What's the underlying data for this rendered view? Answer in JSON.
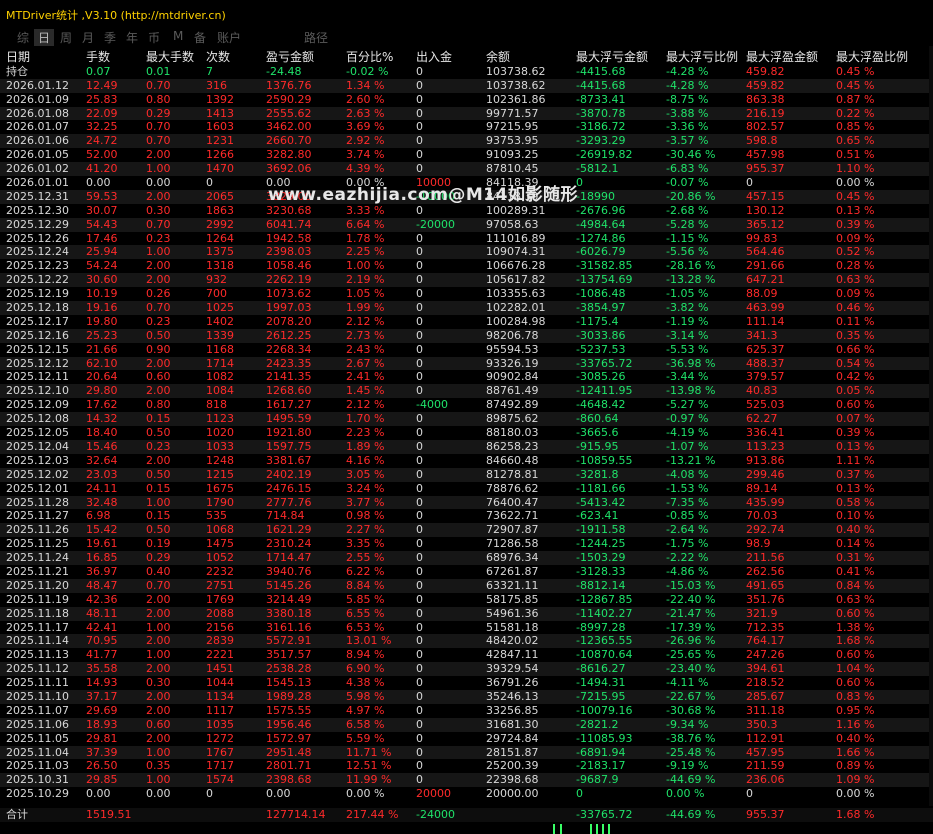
{
  "window": {
    "title": "MTDriver统计 ,V3.10 (http://mtdriver.cn)"
  },
  "tabs": [
    "综",
    "日",
    "周",
    "月",
    "季",
    "年",
    "币",
    "M",
    "备",
    "账户",
    "路径"
  ],
  "active_tab": 1,
  "watermark": "www.eazhijia.com@M14如影随形",
  "colors": {
    "green": "#1fe36a",
    "red": "#ff2a2a",
    "white": "#d8d8d8",
    "title": "#ffd200"
  },
  "table": {
    "headers": [
      "日期",
      "手数",
      "最大手数",
      "次数",
      "盈亏金额",
      "百分比%",
      "出入金",
      "余额",
      "最大浮亏金额",
      "最大浮亏比例",
      "最大浮盈金额",
      "最大浮盈比例"
    ],
    "rows": [
      [
        "持仓",
        "0.07",
        "0.01",
        "7",
        "-24.48",
        "-0.02 %",
        "0",
        "103738.62",
        "-4415.68",
        "-4.28 %",
        "459.82",
        "0.45 %"
      ],
      [
        "2026.01.12",
        "12.49",
        "0.70",
        "316",
        "1376.76",
        "1.34 %",
        "0",
        "103738.62",
        "-4415.68",
        "-4.28 %",
        "459.82",
        "0.45 %"
      ],
      [
        "2026.01.09",
        "25.83",
        "0.80",
        "1392",
        "2590.29",
        "2.60 %",
        "0",
        "102361.86",
        "-8733.41",
        "-8.75 %",
        "863.38",
        "0.87 %"
      ],
      [
        "2026.01.08",
        "22.09",
        "0.29",
        "1413",
        "2555.62",
        "2.63 %",
        "0",
        "99771.57",
        "-3870.78",
        "-3.88 %",
        "216.19",
        "0.22 %"
      ],
      [
        "2026.01.07",
        "32.25",
        "0.70",
        "1603",
        "3462.00",
        "3.69 %",
        "0",
        "97215.95",
        "-3186.72",
        "-3.36 %",
        "802.57",
        "0.85 %"
      ],
      [
        "2026.01.06",
        "24.72",
        "0.70",
        "1231",
        "2660.70",
        "2.92 %",
        "0",
        "93753.95",
        "-3293.29",
        "-3.57 %",
        "598.8",
        "0.65 %"
      ],
      [
        "2026.01.05",
        "52.00",
        "2.00",
        "1266",
        "3282.80",
        "3.74 %",
        "0",
        "91093.25",
        "-26919.82",
        "-30.46 %",
        "457.98",
        "0.51 %"
      ],
      [
        "2026.01.02",
        "41.20",
        "1.00",
        "1470",
        "3692.06",
        "4.39 %",
        "0",
        "87810.45",
        "-5812.1",
        "-6.83 %",
        "955.37",
        "1.10 %"
      ],
      [
        "2026.01.01",
        "0.00",
        "0.00",
        "0",
        "0.00",
        "0.00 %",
        "10000",
        "84118.39",
        "0",
        "-0.07 %",
        "0",
        "0.00 %"
      ],
      [
        "2025.12.31",
        "59.53",
        "2.00",
        "2065",
        "3829.00",
        "",
        "-10000",
        "84118.39",
        "-18990",
        "-20.86 %",
        "457.15",
        "0.45 %"
      ],
      [
        "2025.12.30",
        "30.07",
        "0.30",
        "1863",
        "3230.68",
        "3.33 %",
        "0",
        "100289.31",
        "-2676.96",
        "-2.68 %",
        "130.12",
        "0.13 %"
      ],
      [
        "2025.12.29",
        "54.43",
        "0.70",
        "2992",
        "6041.74",
        "6.64 %",
        "-20000",
        "97058.63",
        "-4984.64",
        "-5.28 %",
        "365.12",
        "0.39 %"
      ],
      [
        "2025.12.26",
        "17.46",
        "0.23",
        "1264",
        "1942.58",
        "1.78 %",
        "0",
        "111016.89",
        "-1274.86",
        "-1.15 %",
        "99.83",
        "0.09 %"
      ],
      [
        "2025.12.24",
        "25.94",
        "1.00",
        "1375",
        "2398.03",
        "2.25 %",
        "0",
        "109074.31",
        "-6026.79",
        "-5.56 %",
        "564.46",
        "0.52 %"
      ],
      [
        "2025.12.23",
        "54.24",
        "2.00",
        "1318",
        "1058.46",
        "1.00 %",
        "0",
        "106676.28",
        "-31582.85",
        "-28.16 %",
        "291.66",
        "0.28 %"
      ],
      [
        "2025.12.22",
        "30.60",
        "2.00",
        "932",
        "2262.19",
        "2.19 %",
        "0",
        "105617.82",
        "-13754.69",
        "-13.28 %",
        "647.21",
        "0.63 %"
      ],
      [
        "2025.12.19",
        "10.19",
        "0.26",
        "700",
        "1073.62",
        "1.05 %",
        "0",
        "103355.63",
        "-1086.48",
        "-1.05 %",
        "88.09",
        "0.09 %"
      ],
      [
        "2025.12.18",
        "19.16",
        "0.70",
        "1025",
        "1997.03",
        "1.99 %",
        "0",
        "102282.01",
        "-3854.97",
        "-3.82 %",
        "463.99",
        "0.46 %"
      ],
      [
        "2025.12.17",
        "19.80",
        "0.23",
        "1402",
        "2078.20",
        "2.12 %",
        "0",
        "100284.98",
        "-1175.4",
        "-1.19 %",
        "111.14",
        "0.11 %"
      ],
      [
        "2025.12.16",
        "25.23",
        "0.50",
        "1339",
        "2612.25",
        "2.73 %",
        "0",
        "98206.78",
        "-3033.86",
        "-3.14 %",
        "341.3",
        "0.35 %"
      ],
      [
        "2025.12.15",
        "21.66",
        "0.90",
        "1168",
        "2268.34",
        "2.43 %",
        "0",
        "95594.53",
        "-5237.53",
        "-5.53 %",
        "625.37",
        "0.66 %"
      ],
      [
        "2025.12.12",
        "62.10",
        "2.00",
        "1714",
        "2423.35",
        "2.67 %",
        "0",
        "93326.19",
        "-33765.72",
        "-36.98 %",
        "488.37",
        "0.54 %"
      ],
      [
        "2025.12.11",
        "20.64",
        "0.60",
        "1082",
        "2141.35",
        "2.41 %",
        "0",
        "90902.84",
        "-3085.26",
        "-3.44 %",
        "379.57",
        "0.42 %"
      ],
      [
        "2025.12.10",
        "29.80",
        "2.00",
        "1084",
        "1268.60",
        "1.45 %",
        "0",
        "88761.49",
        "-12411.95",
        "-13.98 %",
        "40.83",
        "0.05 %"
      ],
      [
        "2025.12.09",
        "17.62",
        "0.80",
        "818",
        "1617.27",
        "2.12 %",
        "-4000",
        "87492.89",
        "-4648.42",
        "-5.27 %",
        "525.03",
        "0.60 %"
      ],
      [
        "2025.12.08",
        "14.32",
        "0.15",
        "1123",
        "1495.59",
        "1.70 %",
        "0",
        "89875.62",
        "-860.64",
        "-0.97 %",
        "62.27",
        "0.07 %"
      ],
      [
        "2025.12.05",
        "18.40",
        "0.50",
        "1020",
        "1921.80",
        "2.23 %",
        "0",
        "88180.03",
        "-3665.6",
        "-4.19 %",
        "336.41",
        "0.39 %"
      ],
      [
        "2025.12.04",
        "15.46",
        "0.23",
        "1033",
        "1597.75",
        "1.89 %",
        "0",
        "86258.23",
        "-915.95",
        "-1.07 %",
        "113.23",
        "0.13 %"
      ],
      [
        "2025.12.03",
        "32.64",
        "2.00",
        "1248",
        "3381.67",
        "4.16 %",
        "0",
        "84660.48",
        "-10859.55",
        "-13.21 %",
        "913.86",
        "1.11 %"
      ],
      [
        "2025.12.02",
        "23.03",
        "0.50",
        "1215",
        "2402.19",
        "3.05 %",
        "0",
        "81278.81",
        "-3281.8",
        "-4.08 %",
        "299.46",
        "0.37 %"
      ],
      [
        "2025.12.01",
        "24.11",
        "0.15",
        "1675",
        "2476.15",
        "3.24 %",
        "0",
        "78876.62",
        "-1181.66",
        "-1.53 %",
        "89.14",
        "0.13 %"
      ],
      [
        "2025.11.28",
        "32.48",
        "1.00",
        "1790",
        "2777.76",
        "3.77 %",
        "0",
        "76400.47",
        "-5413.42",
        "-7.35 %",
        "435.99",
        "0.58 %"
      ],
      [
        "2025.11.27",
        "6.98",
        "0.15",
        "535",
        "714.84",
        "0.98 %",
        "0",
        "73622.71",
        "-623.41",
        "-0.85 %",
        "70.03",
        "0.10 %"
      ],
      [
        "2025.11.26",
        "15.42",
        "0.50",
        "1068",
        "1621.29",
        "2.27 %",
        "0",
        "72907.87",
        "-1911.58",
        "-2.64 %",
        "292.74",
        "0.40 %"
      ],
      [
        "2025.11.25",
        "19.61",
        "0.19",
        "1475",
        "2310.24",
        "3.35 %",
        "0",
        "71286.58",
        "-1244.25",
        "-1.75 %",
        "98.9",
        "0.14 %"
      ],
      [
        "2025.11.24",
        "16.85",
        "0.29",
        "1052",
        "1714.47",
        "2.55 %",
        "0",
        "68976.34",
        "-1503.29",
        "-2.22 %",
        "211.56",
        "0.31 %"
      ],
      [
        "2025.11.21",
        "36.97",
        "0.40",
        "2232",
        "3940.76",
        "6.22 %",
        "0",
        "67261.87",
        "-3128.33",
        "-4.86 %",
        "262.56",
        "0.41 %"
      ],
      [
        "2025.11.20",
        "48.47",
        "0.70",
        "2751",
        "5145.26",
        "8.84 %",
        "0",
        "63321.11",
        "-8812.14",
        "-15.03 %",
        "491.65",
        "0.84 %"
      ],
      [
        "2025.11.19",
        "42.36",
        "2.00",
        "1769",
        "3214.49",
        "5.85 %",
        "0",
        "58175.85",
        "-12867.85",
        "-22.40 %",
        "351.76",
        "0.63 %"
      ],
      [
        "2025.11.18",
        "48.11",
        "2.00",
        "2088",
        "3380.18",
        "6.55 %",
        "0",
        "54961.36",
        "-11402.27",
        "-21.47 %",
        "321.9",
        "0.60 %"
      ],
      [
        "2025.11.17",
        "42.41",
        "1.00",
        "2156",
        "3161.16",
        "6.53 %",
        "0",
        "51581.18",
        "-8997.28",
        "-17.39 %",
        "712.35",
        "1.38 %"
      ],
      [
        "2025.11.14",
        "70.95",
        "2.00",
        "2839",
        "5572.91",
        "13.01 %",
        "0",
        "48420.02",
        "-12365.55",
        "-26.96 %",
        "764.17",
        "1.68 %"
      ],
      [
        "2025.11.13",
        "41.77",
        "1.00",
        "2221",
        "3517.57",
        "8.94 %",
        "0",
        "42847.11",
        "-10870.64",
        "-25.65 %",
        "247.26",
        "0.60 %"
      ],
      [
        "2025.11.12",
        "35.58",
        "2.00",
        "1451",
        "2538.28",
        "6.90 %",
        "0",
        "39329.54",
        "-8616.27",
        "-23.40 %",
        "394.61",
        "1.04 %"
      ],
      [
        "2025.11.11",
        "14.93",
        "0.30",
        "1044",
        "1545.13",
        "4.38 %",
        "0",
        "36791.26",
        "-1494.31",
        "-4.11 %",
        "218.52",
        "0.60 %"
      ],
      [
        "2025.11.10",
        "37.17",
        "2.00",
        "1134",
        "1989.28",
        "5.98 %",
        "0",
        "35246.13",
        "-7215.95",
        "-22.67 %",
        "285.67",
        "0.83 %"
      ],
      [
        "2025.11.07",
        "29.69",
        "2.00",
        "1117",
        "1575.55",
        "4.97 %",
        "0",
        "33256.85",
        "-10079.16",
        "-30.68 %",
        "311.18",
        "0.95 %"
      ],
      [
        "2025.11.06",
        "18.93",
        "0.60",
        "1035",
        "1956.46",
        "6.58 %",
        "0",
        "31681.30",
        "-2821.2",
        "-9.34 %",
        "350.3",
        "1.16 %"
      ],
      [
        "2025.11.05",
        "29.81",
        "2.00",
        "1272",
        "1572.97",
        "5.59 %",
        "0",
        "29724.84",
        "-11085.93",
        "-38.76 %",
        "112.91",
        "0.40 %"
      ],
      [
        "2025.11.04",
        "37.39",
        "1.00",
        "1767",
        "2951.48",
        "11.71 %",
        "0",
        "28151.87",
        "-6891.94",
        "-25.48 %",
        "457.95",
        "1.66 %"
      ],
      [
        "2025.11.03",
        "26.50",
        "0.35",
        "1717",
        "2801.71",
        "12.51 %",
        "0",
        "25200.39",
        "-2183.17",
        "-9.19 %",
        "211.59",
        "0.89 %"
      ],
      [
        "2025.10.31",
        "29.85",
        "1.00",
        "1574",
        "2398.68",
        "11.99 %",
        "0",
        "22398.68",
        "-9687.9",
        "-44.69 %",
        "236.06",
        "1.09 %"
      ],
      [
        "2025.10.29",
        "0.00",
        "0.00",
        "0",
        "0.00",
        "0.00 %",
        "20000",
        "20000.00",
        "0",
        "0.00 %",
        "0",
        "0.00 %"
      ]
    ],
    "footer": [
      "合计",
      "1519.51",
      "",
      "",
      "127714.14",
      "217.44 %",
      "-24000",
      "",
      "-33765.72",
      "-44.69 %",
      "955.37",
      "1.68 %"
    ]
  }
}
